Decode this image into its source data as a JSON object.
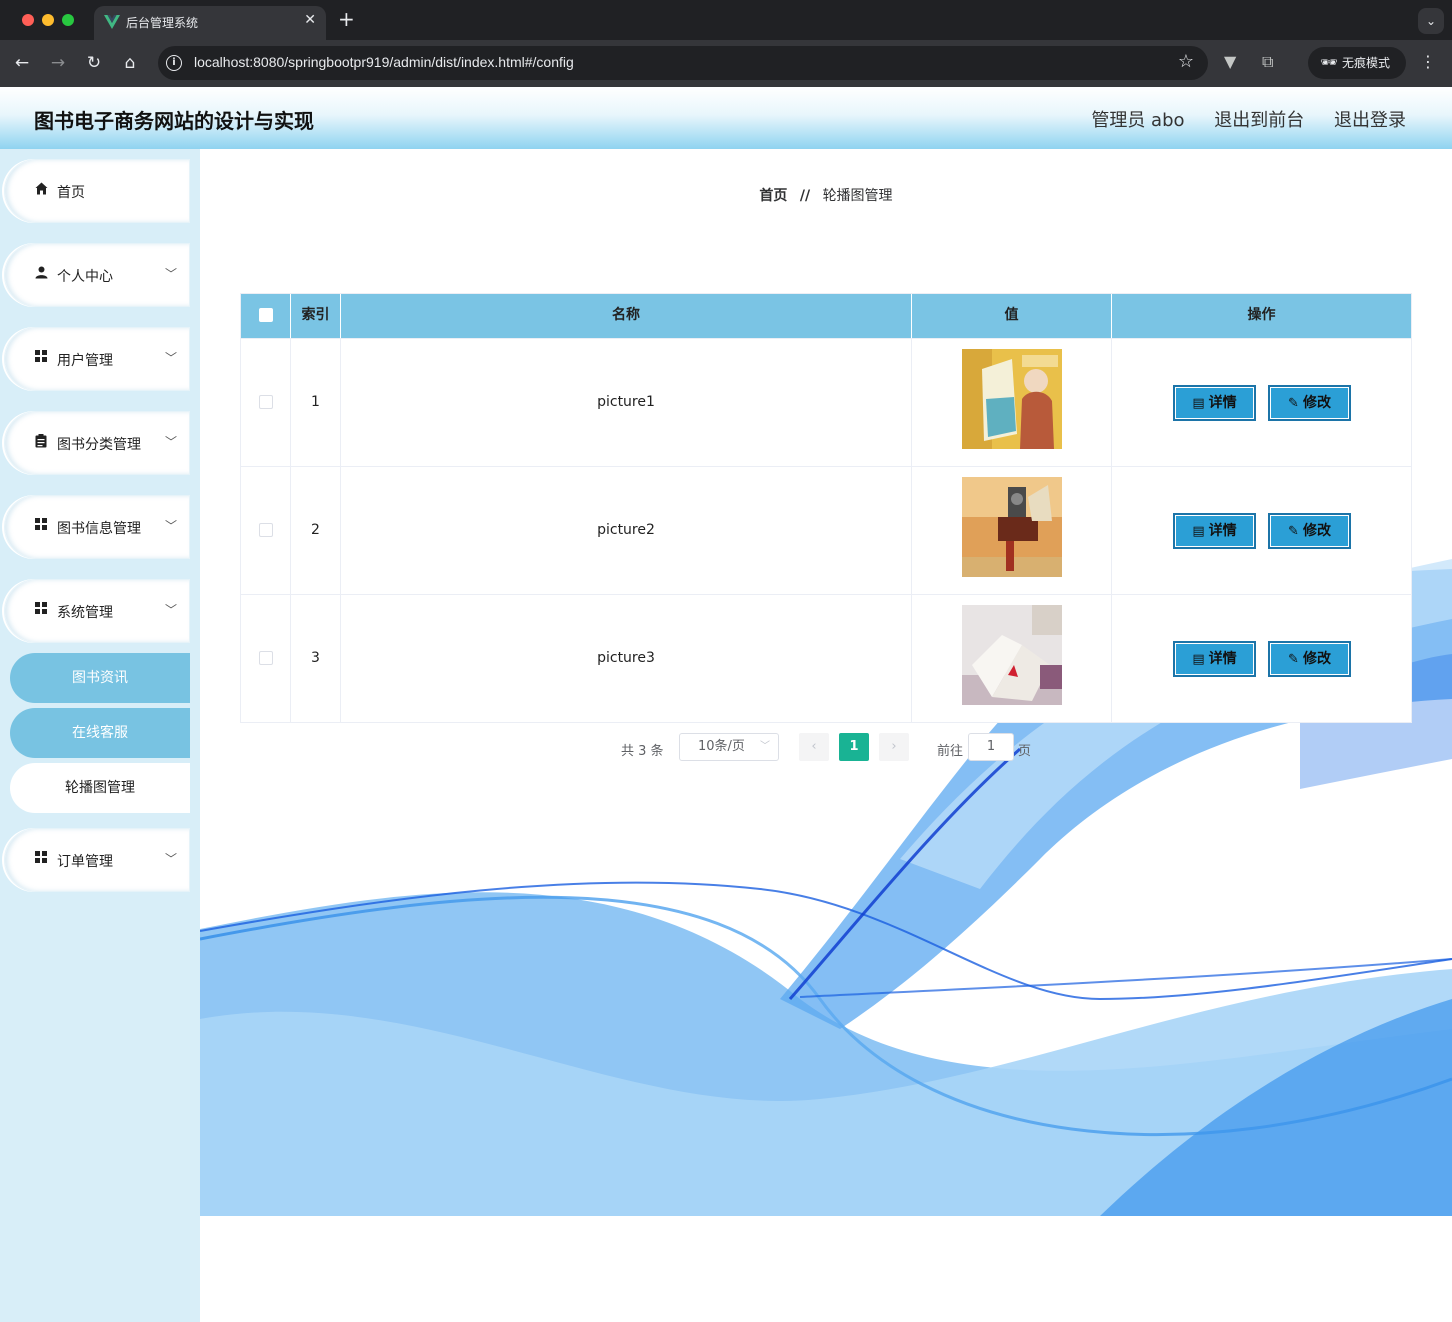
{
  "browser": {
    "tab_title": "后台管理系统",
    "tab_close": "✕",
    "new_tab": "+",
    "url": "localhost:8080/springbootpr919/admin/dist/index.html#/config",
    "incognito_label": "无痕模式"
  },
  "header": {
    "title": "图书电子商务网站的设计与实现",
    "user_label": "管理员 abo",
    "to_front_label": "退出到前台",
    "logout_label": "退出登录"
  },
  "sidebar": {
    "items": [
      {
        "label": "首页",
        "icon": "home-icon"
      },
      {
        "label": "个人中心",
        "icon": "user-icon"
      },
      {
        "label": "用户管理",
        "icon": "grid-icon"
      },
      {
        "label": "图书分类管理",
        "icon": "clipboard-icon"
      },
      {
        "label": "图书信息管理",
        "icon": "grid-icon"
      },
      {
        "label": "系统管理",
        "icon": "grid-icon"
      },
      {
        "label": "订单管理",
        "icon": "grid-icon"
      }
    ],
    "sub_items": [
      {
        "label": "图书资讯"
      },
      {
        "label": "在线客服"
      },
      {
        "label": "轮播图管理"
      }
    ]
  },
  "breadcrumb": {
    "home": "首页",
    "separator": "//",
    "current": "轮播图管理"
  },
  "table": {
    "columns": [
      "索引",
      "名称",
      "值",
      "操作"
    ],
    "rows": [
      {
        "index": "1",
        "name": "picture1",
        "image": "picture1-thumbnail"
      },
      {
        "index": "2",
        "name": "picture2",
        "image": "picture2-thumbnail"
      },
      {
        "index": "3",
        "name": "picture3",
        "image": "picture3-thumbnail"
      }
    ],
    "detail_label": "详情",
    "edit_label": "修改"
  },
  "pagination": {
    "total_text": "共 3 条",
    "page_size": "10条/页",
    "current_page": "1",
    "goto_label": "前往",
    "goto_value": "1",
    "page_suffix": "页"
  },
  "colors": {
    "header_gradient_end": "#8fd3f0",
    "sidebar_bg": "#d8eef8",
    "table_header": "#7ac4e4",
    "button_bg": "#2b9fd6",
    "pagination_active": "#19b394"
  }
}
